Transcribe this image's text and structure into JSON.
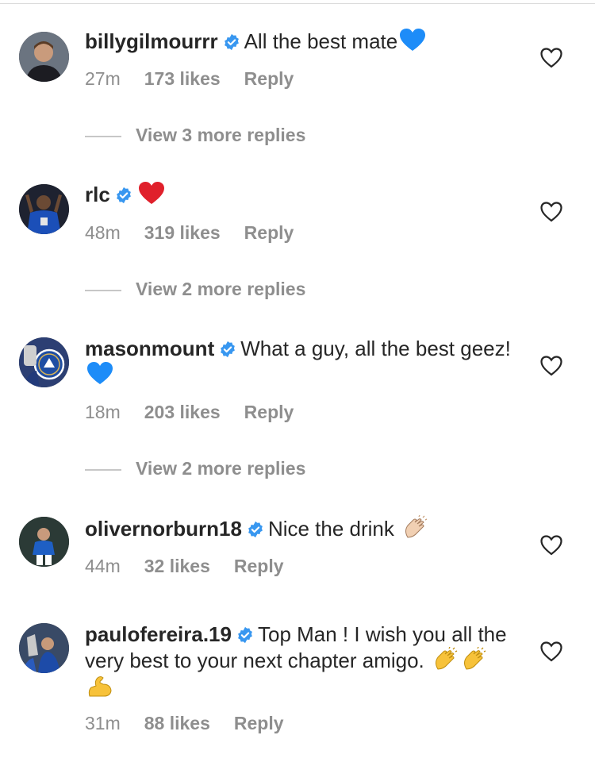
{
  "comments": [
    {
      "username": "billygilmourrr",
      "text": "All the best mate",
      "emoji": "blue-heart",
      "time": "27m",
      "likes": "173 likes",
      "reply": "Reply"
    },
    {
      "username": "rlc",
      "text": "",
      "emoji": "red-heart",
      "time": "48m",
      "likes": "319 likes",
      "reply": "Reply"
    },
    {
      "username": "masonmount",
      "text": "What a guy, all the best geez!",
      "emoji": "blue-heart",
      "time": "18m",
      "likes": "203 likes",
      "reply": "Reply"
    },
    {
      "username": "olivernorburn18",
      "text": "Nice the drink",
      "emoji": "clapping-hands",
      "time": "44m",
      "likes": "32 likes",
      "reply": "Reply"
    },
    {
      "username": "paulofereira.19",
      "text": "Top Man ! I wish you all the very best to your next chapter amigo.",
      "emoji": "clapping-hands clapping-hands flexed-biceps",
      "time": "31m",
      "likes": "88 likes",
      "reply": "Reply"
    }
  ],
  "view_more": [
    "View 3 more replies",
    "View 2 more replies",
    "View 2 more replies"
  ],
  "colors": {
    "text": "#262626",
    "secondary": "#8e8e8e",
    "verified": "#3897f0",
    "blue_heart": "#1d8cf8",
    "red_heart": "#e0202b"
  },
  "icons": {
    "verified": "verified-badge-icon",
    "like": "heart-outline-icon"
  }
}
